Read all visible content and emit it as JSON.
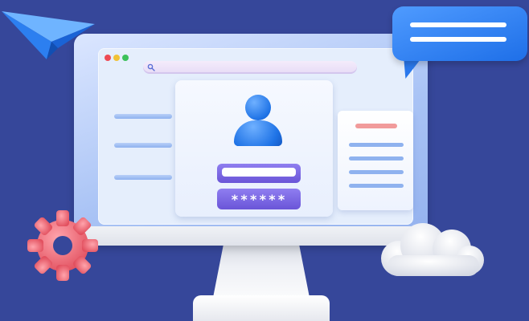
{
  "login": {
    "password_mask": "******"
  },
  "colors": {
    "background": "#36479a",
    "monitor": "#a9c3f5",
    "screen": "#e5eefc",
    "user_icon": "#1f73e6",
    "input_fields": "#6a55d8",
    "bubble": "#1e6fe8",
    "gear": "#f0707e",
    "list_header": "#f19b9b"
  },
  "icons": {
    "paper_plane": "paper-plane-icon",
    "chat_bubble": "chat-bubble-icon",
    "gear": "gear-icon",
    "cloud": "cloud-icon",
    "user": "user-icon",
    "search": "search-icon"
  }
}
